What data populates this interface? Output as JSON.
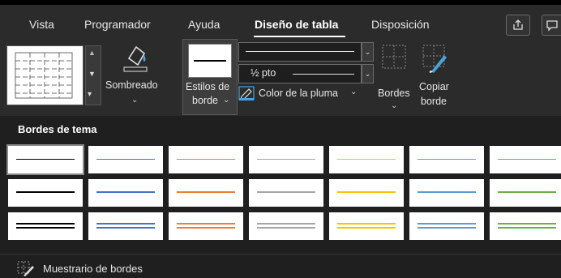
{
  "tabs": [
    {
      "label": "Vista"
    },
    {
      "label": "Programador"
    },
    {
      "label": "Ayuda"
    },
    {
      "label": "Diseño de tabla",
      "active": true
    },
    {
      "label": "Disposición"
    }
  ],
  "titlebar_icons": [
    "share-icon",
    "comment-icon"
  ],
  "ribbon": {
    "sombreado_label": "Sombreado",
    "estilos_label_1": "Estilos de",
    "estilos_label_2": "borde",
    "line_weight_value": "½ pto",
    "color_pluma_label": "Color de la pluma",
    "bordes_label": "Bordes",
    "copiar_label_1": "Copiar",
    "copiar_label_2": "borde"
  },
  "gallery": {
    "title": "Bordes de tema",
    "row_styles": [
      "thin",
      "medium",
      "double"
    ],
    "column_colors": [
      "#000000",
      "#4472c4",
      "#ed7d31",
      "#a5a5a5",
      "#ffc000",
      "#5b9bd5",
      "#70ad47"
    ],
    "selected": [
      0,
      0
    ]
  },
  "footer": {
    "muestrario_label": "Muestrario de bordes"
  },
  "colors": {
    "background": "#1f1f1f",
    "ribbon": "#2b2b2b",
    "accent_text": "#ffffff"
  }
}
